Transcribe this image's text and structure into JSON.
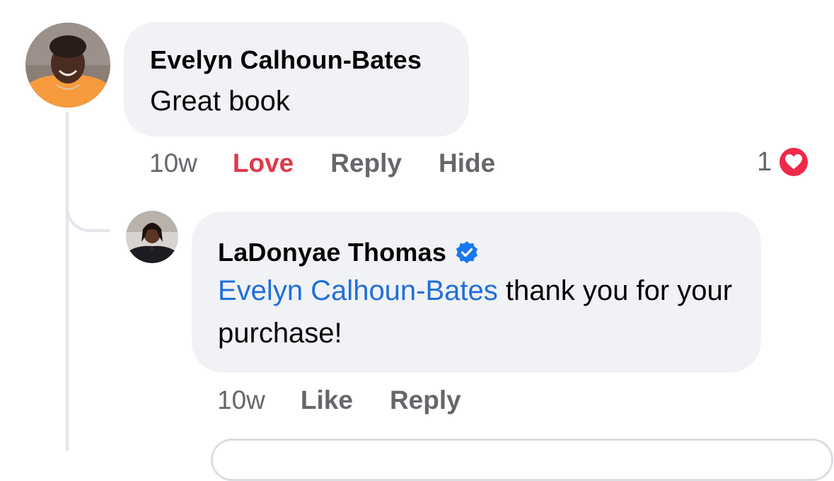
{
  "comment": {
    "author": "Evelyn Calhoun-Bates",
    "text": "Great book",
    "timestamp": "10w",
    "actions": {
      "love": "Love",
      "reply": "Reply",
      "hide": "Hide"
    },
    "reactions": {
      "count": "1",
      "icon": "heart-icon",
      "color": "#f0284a"
    },
    "avatar_icon": "avatar"
  },
  "reply": {
    "author": "LaDonyae Thomas",
    "verified": true,
    "mention": "Evelyn Calhoun-Bates",
    "text": " thank you for your purchase!",
    "timestamp": "10w",
    "actions": {
      "like": "Like",
      "reply": "Reply"
    },
    "avatar_icon": "avatar"
  },
  "colors": {
    "bubble": "#f0f2f5",
    "secondary_text": "#65676b",
    "love": "#e0384a",
    "mention": "#216fdb",
    "verified": "#1877f2",
    "thread_line": "#e4e6eb"
  }
}
